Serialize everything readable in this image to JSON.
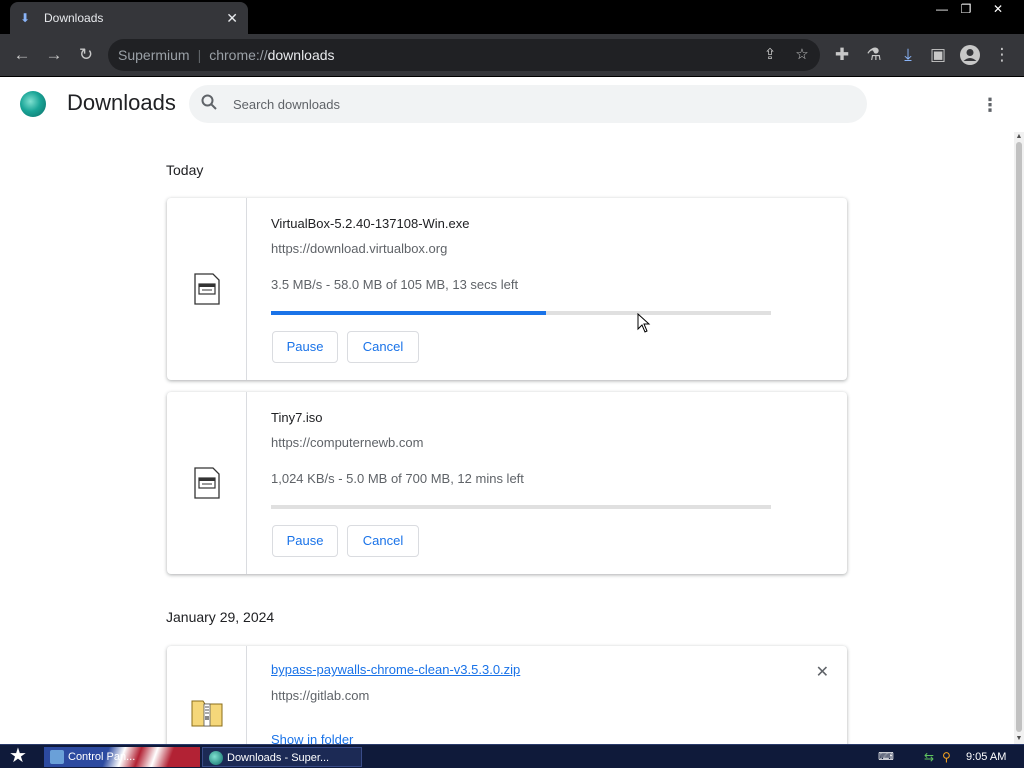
{
  "window": {
    "tab_title": "Downloads",
    "min_label": "—",
    "restore_label": "❐",
    "close_label": "✕"
  },
  "toolbar": {
    "omnibox_scheme": "Supermium",
    "omnibox_separator": "|",
    "omnibox_url_prefix": "chrome://",
    "omnibox_url_host": "downloads"
  },
  "page": {
    "title": "Downloads",
    "search_placeholder": "Search downloads"
  },
  "groups": [
    {
      "date": "Today",
      "items": [
        {
          "name": "VirtualBox-5.2.40-137108-Win.exe",
          "url": "https://download.virtualbox.org",
          "status": "3.5 MB/s - 58.0 MB of 105 MB, 13 secs left",
          "progress_percent": 55,
          "pause_label": "Pause",
          "cancel_label": "Cancel"
        },
        {
          "name": "Tiny7.iso",
          "url": "https://computernewb.com",
          "status": "1,024 KB/s - 5.0 MB of 700 MB, 12 mins left",
          "progress_percent": 0,
          "pause_label": "Pause",
          "cancel_label": "Cancel"
        }
      ]
    },
    {
      "date": "January 29, 2024",
      "items": [
        {
          "name": "bypass-paywalls-chrome-clean-v3.5.3.0.zip",
          "url": "https://gitlab.com",
          "show_in_folder_label": "Show in folder"
        }
      ]
    }
  ],
  "taskbar": {
    "task1_label": "Control Pan...",
    "task2_label": "Downloads - Super...",
    "clock": "9:05 AM"
  },
  "colors": {
    "accent": "#1a73e8",
    "toolbar_bg": "#35363a",
    "tabstrip_bg": "#000000"
  }
}
